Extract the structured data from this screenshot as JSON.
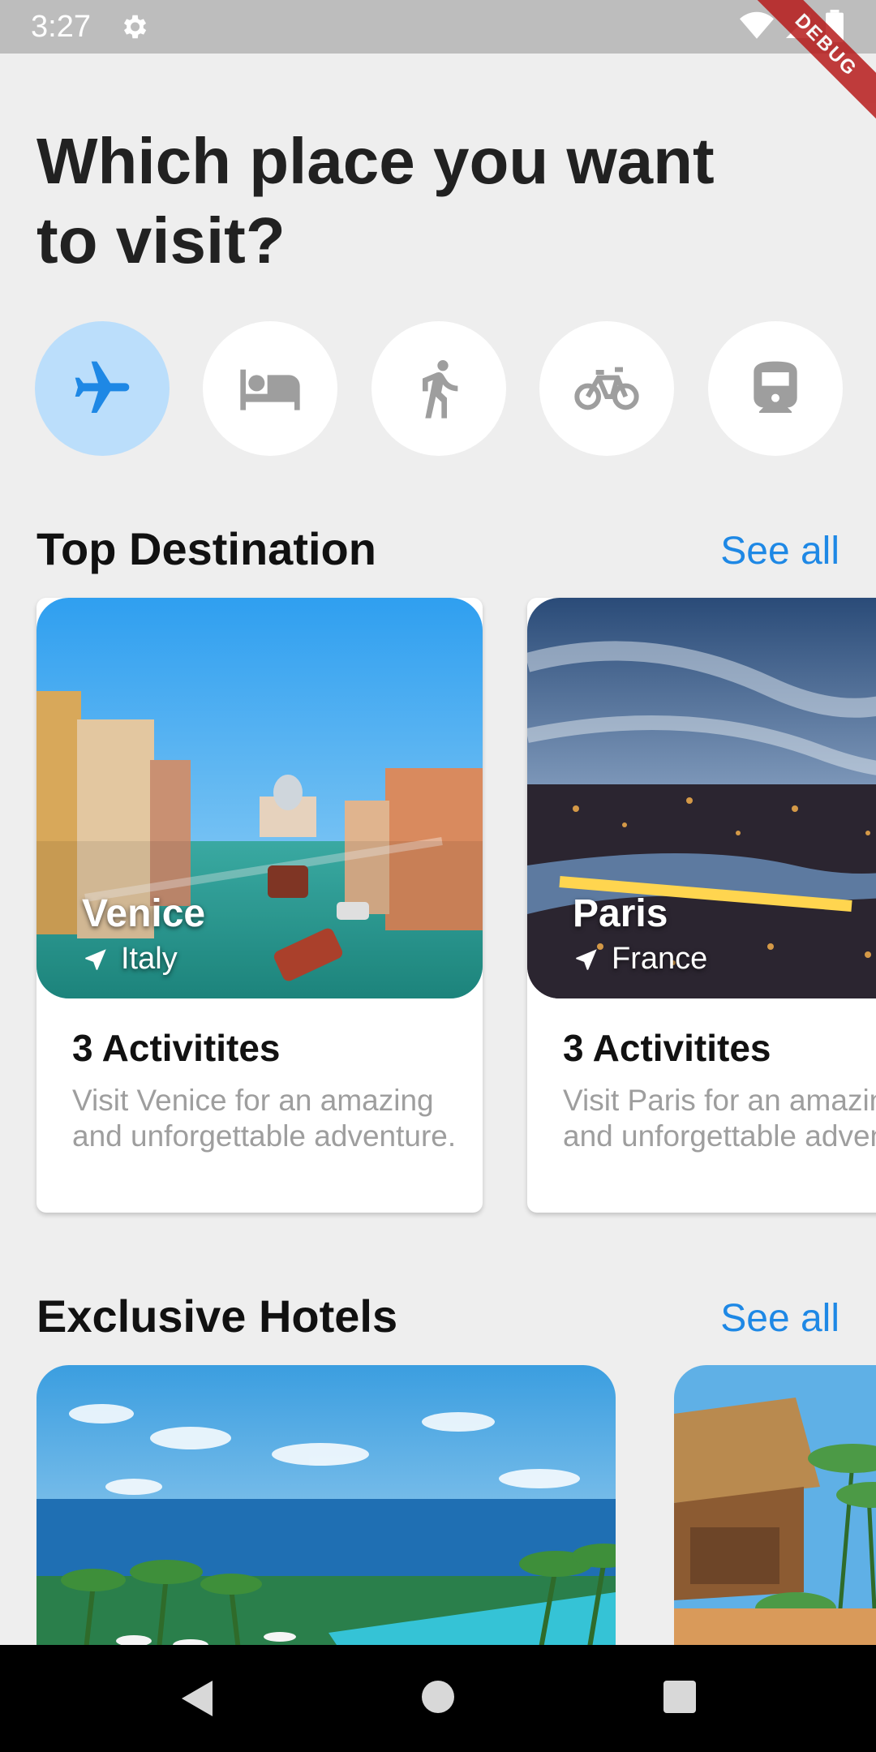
{
  "status": {
    "time": "3:27",
    "debug_label": "DEBUG"
  },
  "header": {
    "title": "Which place you want to visit?"
  },
  "categories": [
    {
      "icon": "airplane-icon",
      "active": true
    },
    {
      "icon": "bed-icon",
      "active": false
    },
    {
      "icon": "walking-icon",
      "active": false
    },
    {
      "icon": "bicycle-icon",
      "active": false
    },
    {
      "icon": "train-icon",
      "active": false
    }
  ],
  "top_destination": {
    "title": "Top Destination",
    "see_all": "See all",
    "cards": [
      {
        "city": "Venice",
        "country": "Italy",
        "activities": "3 Activitites",
        "description": "Visit Venice for an amazing and unforgettable adventure."
      },
      {
        "city": "Paris",
        "country": "France",
        "activities": "3 Activitites",
        "description": "Visit Paris for an amazing and unforgettable adventure."
      }
    ]
  },
  "exclusive_hotels": {
    "title": "Exclusive Hotels",
    "see_all": "See all"
  },
  "colors": {
    "accent": "#1e88e5",
    "active_category": "#bbdefb",
    "background": "#eeeeee"
  }
}
